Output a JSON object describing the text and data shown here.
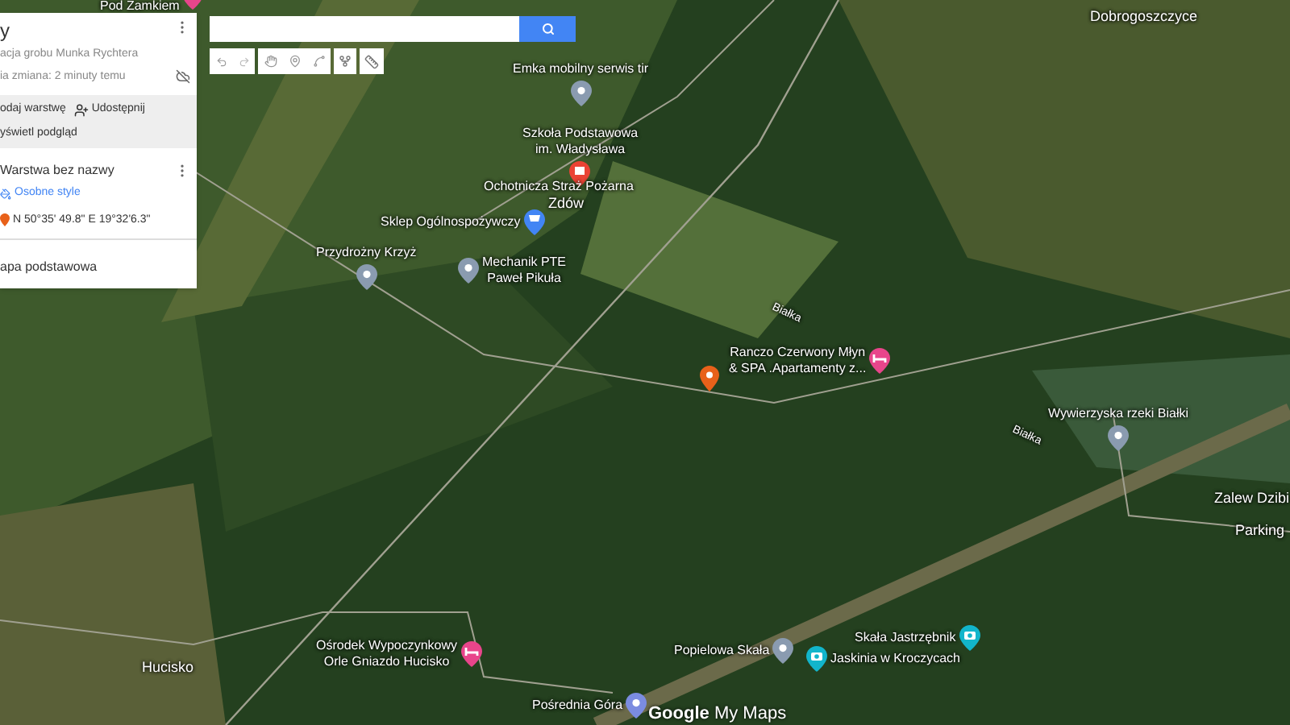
{
  "panel": {
    "title": "y",
    "subtitle": "acja grobu Munka Rychtera",
    "last_edit": "ia zmiana: 2 minuty temu",
    "actions": [
      "odaj warstwę",
      "Udostępnij"
    ],
    "preview": "yświetl podgląd",
    "layer": {
      "name": "Warstwa bez nazwy",
      "style_link": "Osobne style",
      "point": "N 50°35' 49.8\" E 19°32'6.3\""
    },
    "base_map": "apa podstawowa"
  },
  "map_labels": [
    {
      "lines": [
        "Pod Zamkiem"
      ],
      "kind": "hotel",
      "color": "#e8458b"
    },
    {
      "lines": [
        "Dobrogoszczyce"
      ],
      "kind": "place"
    },
    {
      "lines": [
        "Emka mobilny serwis tir"
      ],
      "kind": "pin",
      "color": "#8a9bb0"
    },
    {
      "lines": [
        "Szkoła Podstawowa",
        "im. Władysława"
      ],
      "kind": "school",
      "color": "#ea4335"
    },
    {
      "lines": [
        "Ochotnicza Straż Pożarna"
      ],
      "kind": "label"
    },
    {
      "lines": [
        "Zdów"
      ],
      "kind": "place"
    },
    {
      "lines": [
        "Sklep Ogólnospożywczy"
      ],
      "kind": "shop",
      "color": "#4285f4"
    },
    {
      "lines": [
        "Przydrożny Krzyż"
      ],
      "kind": "pin",
      "color": "#8a9bb0"
    },
    {
      "lines": [
        "Mechanik PTE",
        "Paweł Pikuła"
      ],
      "kind": "pin",
      "color": "#8a9bb0"
    },
    {
      "lines": [
        "Ranczo Czerwony Młyn",
        "& SPA .Apartamenty z..."
      ],
      "kind": "hotel",
      "color": "#e8458b"
    },
    {
      "lines": [
        "Białka"
      ],
      "kind": "road"
    },
    {
      "lines": [
        "Wywierzyska rzeki Białki"
      ],
      "kind": "pin",
      "color": "#8a9bb0"
    },
    {
      "lines": [
        "Białka"
      ],
      "kind": "road"
    },
    {
      "lines": [
        "Zalew Dzibi"
      ],
      "kind": "place"
    },
    {
      "lines": [
        "Parking"
      ],
      "kind": "place"
    },
    {
      "lines": [
        "Hucisko"
      ],
      "kind": "place"
    },
    {
      "lines": [
        "Ośrodek Wypoczynkowy",
        "Orle Gniazdo Hucisko"
      ],
      "kind": "hotel",
      "color": "#e8458b"
    },
    {
      "lines": [
        "Popielowa Skała"
      ],
      "kind": "pin",
      "color": "#8a9bb0"
    },
    {
      "lines": [
        "Skała Jastrzębnik"
      ],
      "kind": "camera",
      "color": "#12b5cb"
    },
    {
      "lines": [
        "Jaskinia w Kroczycach"
      ],
      "kind": "camera",
      "color": "#12b5cb"
    },
    {
      "lines": [
        "Pośrednia Góra"
      ],
      "kind": "pin",
      "color": "#7b8ce0"
    }
  ],
  "logo": {
    "brand": "Google",
    "product": "My Maps"
  }
}
